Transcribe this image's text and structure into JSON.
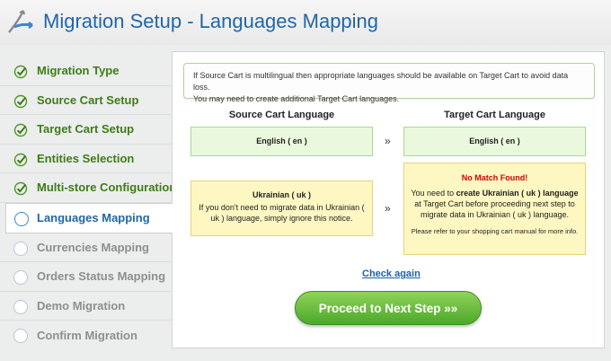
{
  "header": {
    "title": "Migration Setup - Languages Mapping",
    "logo_icon": "cart-arrow-logo-icon"
  },
  "sidebar": {
    "items": [
      {
        "label": "Migration Type",
        "state": "done",
        "icon": "check-icon"
      },
      {
        "label": "Source Cart Setup",
        "state": "done",
        "icon": "check-icon"
      },
      {
        "label": "Target Cart Setup",
        "state": "done",
        "icon": "check-icon"
      },
      {
        "label": "Entities Selection",
        "state": "done",
        "icon": "check-icon"
      },
      {
        "label": "Multi-store Configuration",
        "state": "done",
        "icon": "check-icon"
      },
      {
        "label": "Languages Mapping",
        "state": "active",
        "icon": "circle-icon"
      },
      {
        "label": "Currencies Mapping",
        "state": "pending",
        "icon": "circle-icon"
      },
      {
        "label": "Orders Status Mapping",
        "state": "pending",
        "icon": "circle-icon"
      },
      {
        "label": "Demo Migration",
        "state": "pending",
        "icon": "circle-icon"
      },
      {
        "label": "Confirm Migration",
        "state": "pending",
        "icon": "circle-icon"
      }
    ]
  },
  "notice": {
    "line1": "If Source Cart is multilingual then appropriate languages should be available on Target Cart to avoid data loss.",
    "line2": "You may need to create additional Target Cart languages."
  },
  "columns": {
    "source": "Source Cart Language",
    "target": "Target Cart Language"
  },
  "rows": [
    {
      "source": "English ( en )",
      "arrow": "»",
      "target": "English ( en )"
    },
    {
      "source": "Ukrainian ( uk )",
      "source_note": "If you don't need to migrate data in Ukrainian ( uk ) language, simply ignore this notice.",
      "arrow": "»",
      "target_title": "No Match Found!",
      "target_pre": "You need to ",
      "target_bold": "create Ukrainian ( uk ) language",
      "target_post": " at Target Cart before proceeding next step to migrate data in Ukrainian ( uk ) language.",
      "target_help": "Please refer to your shopping cart manual for more info."
    }
  ],
  "actions": {
    "check_again": "Check again",
    "proceed": "Proceed to Next Step »»"
  },
  "colors": {
    "title_blue": "#1f66a8",
    "done_green": "#3d7d16",
    "match_green_bg": "#eaf9dd",
    "nomatch_yellow_bg": "#fff7c2",
    "error_red": "#d40000"
  }
}
